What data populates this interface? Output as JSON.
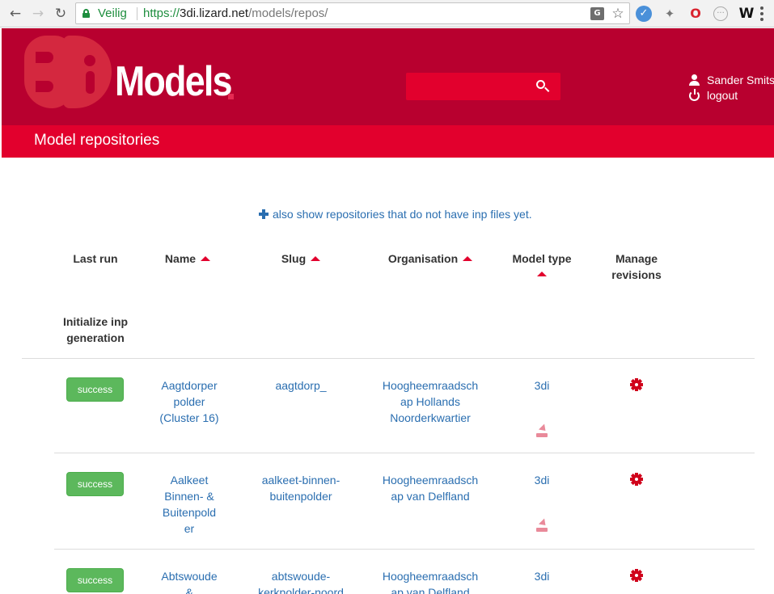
{
  "browser": {
    "secure_label": "Veilig",
    "url_scheme": "https://",
    "url_host": "3di.lizard.net",
    "url_path": "/models/repos/"
  },
  "header": {
    "brand": "Models",
    "logo_mark": "3Di",
    "search": {
      "placeholder": "",
      "value": ""
    },
    "user": {
      "name": "Sander Smits",
      "logout_label": "logout"
    }
  },
  "page": {
    "title": "Model repositories",
    "show_all_link": "also show repositories that do not have inp files yet."
  },
  "table": {
    "columns": {
      "last_run": "Last run",
      "name": "Name",
      "slug": "Slug",
      "organisation": "Organisation",
      "model_type": "Model type",
      "manage_revisions_line1": "Manage",
      "manage_revisions_line2": "revisions",
      "init_inp_line1": "Initialize inp",
      "init_inp_line2": "generation"
    },
    "rows": [
      {
        "status": "success",
        "name_lines": [
          "Aagtdorper",
          "polder",
          "(Cluster 16)"
        ],
        "slug_lines": [
          "aagtdorp_"
        ],
        "org_lines": [
          "Hoogheemraadsch",
          "ap Hollands",
          "Noorderkwartier"
        ],
        "model_type": "3di"
      },
      {
        "status": "success",
        "name_lines": [
          "Aalkeet",
          "Binnen- &",
          "Buitenpold",
          "er"
        ],
        "slug_lines": [
          "aalkeet-binnen-",
          "buitenpolder"
        ],
        "org_lines": [
          "Hoogheemraadsch",
          "ap van Delfland"
        ],
        "model_type": "3di"
      },
      {
        "status": "success",
        "name_lines": [
          "Abtswoude",
          "&"
        ],
        "slug_lines": [
          "abtswoude-",
          "kerkpolder-noord"
        ],
        "org_lines": [
          "Hoogheemraadsch",
          "ap van Delfland"
        ],
        "model_type": "3di"
      }
    ]
  },
  "colors": {
    "header_dark": "#b8002f",
    "header_bright": "#e2002d",
    "link": "#2a6eb0",
    "success": "#5cb85c",
    "gear": "#d0021b"
  }
}
